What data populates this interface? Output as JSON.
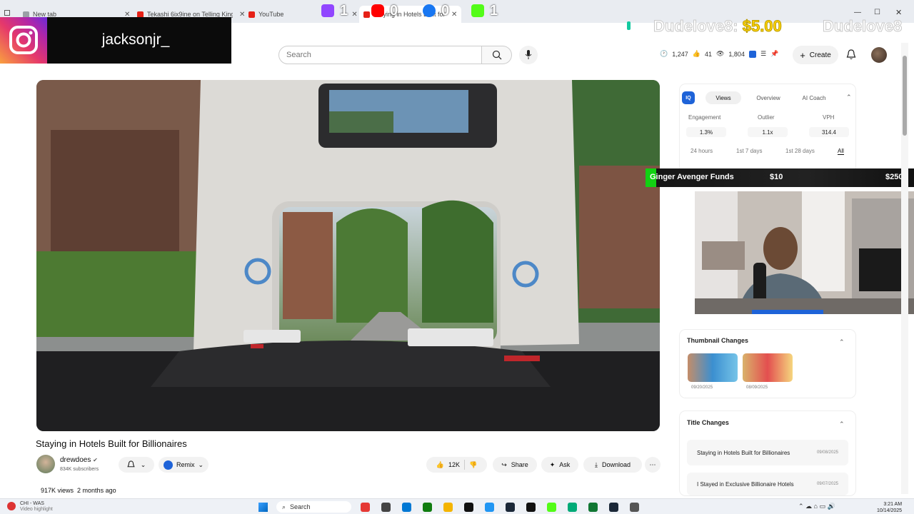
{
  "browser": {
    "tabs": [
      {
        "title": "New tab",
        "color": "#9aa0a6"
      },
      {
        "title": "Tekashi 6ix9ine on Telling King V...",
        "color": "#e62117"
      },
      {
        "title": "YouTube",
        "color": "#e62117"
      },
      {
        "title": "Staying in Hotels Built for Bil...",
        "color": "#e62117"
      }
    ]
  },
  "overlay": {
    "instagram_handle": "jacksonjr_",
    "counters": [
      {
        "platform": "twitch",
        "value": "1",
        "color": "#9146ff"
      },
      {
        "platform": "youtube",
        "value": "0",
        "color": "#ff0000"
      },
      {
        "platform": "facebook",
        "value": "0",
        "color": "#1877f2"
      },
      {
        "platform": "kick",
        "value": "1",
        "color": "#53fc18"
      }
    ],
    "donation_name": "Dudelove8:",
    "donation_amount": "$5.00",
    "donation_name_repeat": "Dudelove8",
    "funds": {
      "label": "Ginger Avenger Funds",
      "current": "$10",
      "goal": "$250",
      "progress": 0.04
    }
  },
  "youtube": {
    "search_placeholder": "Search",
    "stats": {
      "views": "1,247",
      "likes": "41",
      "watching": "1,804"
    },
    "create_label": "Create",
    "video": {
      "title": "Staying in Hotels Built for Billionaires",
      "channel": "drewdoes",
      "subscribers": "834K subscribers",
      "remix_label": "Remix",
      "likes": "12K",
      "share_label": "Share",
      "ask_label": "Ask",
      "download_label": "Download",
      "views": "917K views",
      "age": "2 months ago"
    }
  },
  "vidiq": {
    "badge": "IQ",
    "tabs": [
      "Views",
      "Overview",
      "AI Coach"
    ],
    "metrics": [
      {
        "label": "Engagement",
        "value": "1.3%"
      },
      {
        "label": "Outlier",
        "value": "1.1x"
      },
      {
        "label": "VPH",
        "value": "314.4"
      }
    ],
    "ranges": [
      "24 hours",
      "1st 7 days",
      "1st 28 days",
      "All"
    ],
    "thumbnail_changes": {
      "title": "Thumbnail Changes",
      "items": [
        {
          "date": "09/20/2025"
        },
        {
          "date": "08/09/2025"
        }
      ]
    },
    "title_changes": {
      "title": "Title Changes",
      "items": [
        {
          "title": "Staying in Hotels Built for Billionaires",
          "date": "09/08/2025"
        },
        {
          "title": "I Stayed in Exclusive Billionaire Hotels",
          "date": "09/07/2025"
        }
      ]
    }
  },
  "taskbar": {
    "weather_line1": "CHI - WAS",
    "weather_line2": "Video highlight",
    "search_label": "Search",
    "time": "3:21 AM",
    "date": "10/14/2025",
    "apps": [
      "#e53935",
      "#444",
      "#0078d4",
      "#107c10",
      "#f4b400",
      "#111",
      "#2196f3",
      "#1b2838",
      "#111",
      "#53fc18",
      "#0a7",
      "#173",
      "#1b2838",
      "#555"
    ]
  }
}
